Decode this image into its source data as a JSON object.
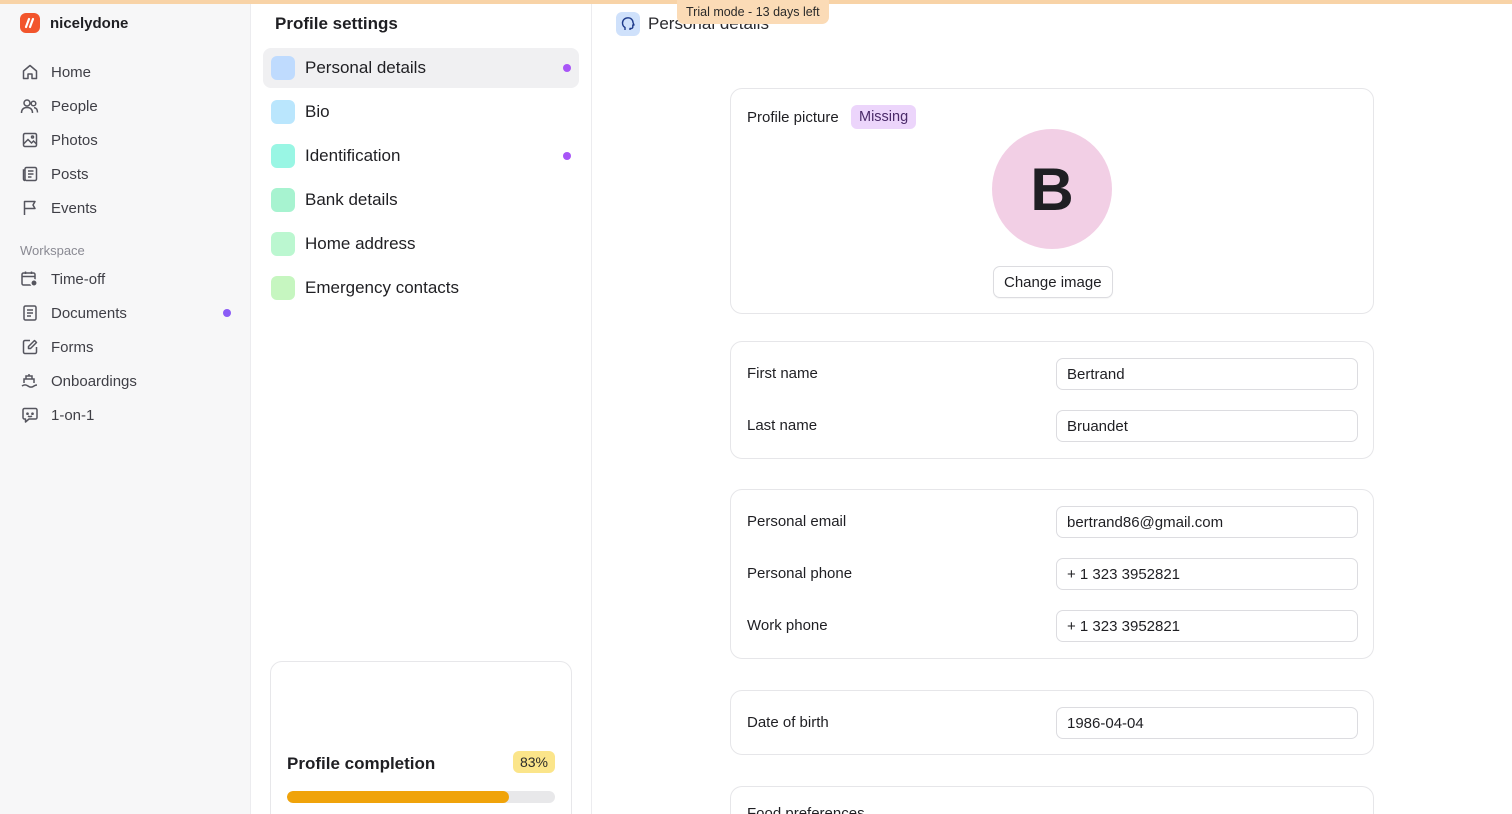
{
  "trial_badge": "Trial mode - 13 days left",
  "brand": {
    "name": "nicelydone",
    "logo_color": "#f2552c"
  },
  "sidebar": {
    "items": [
      {
        "label": "Home",
        "icon": "home-icon"
      },
      {
        "label": "People",
        "icon": "people-icon"
      },
      {
        "label": "Photos",
        "icon": "photos-icon"
      },
      {
        "label": "Posts",
        "icon": "posts-icon"
      },
      {
        "label": "Events",
        "icon": "flag-icon"
      }
    ],
    "workspace_label": "Workspace",
    "workspace_items": [
      {
        "label": "Time-off",
        "icon": "calendar-clock-icon"
      },
      {
        "label": "Documents",
        "icon": "document-icon",
        "dot": true
      },
      {
        "label": "Forms",
        "icon": "form-icon"
      },
      {
        "label": "Onboardings",
        "icon": "onboarding-icon"
      },
      {
        "label": "1-on-1",
        "icon": "chat-icon"
      }
    ]
  },
  "settings": {
    "title": "Profile settings",
    "menu": [
      {
        "label": "Personal details",
        "color": "#bfdbfe",
        "dot": true,
        "active": true
      },
      {
        "label": "Bio",
        "color": "#bae6fd",
        "dot": false
      },
      {
        "label": "Identification",
        "color": "#99f6e4",
        "dot": true
      },
      {
        "label": "Bank details",
        "color": "#a7f3d0",
        "dot": false
      },
      {
        "label": "Home address",
        "color": "#bbf7d0",
        "dot": false
      },
      {
        "label": "Emergency contacts",
        "color": "#c6f6c0",
        "dot": false
      }
    ],
    "completion": {
      "title": "Profile completion",
      "percent_label": "83%",
      "percent": 83
    }
  },
  "main": {
    "header_title": "Personal details",
    "profile_picture": {
      "label": "Profile picture",
      "badge": "Missing",
      "avatar_letter": "B",
      "button": "Change image"
    },
    "name": {
      "first_label": "First name",
      "first_value": "Bertrand",
      "last_label": "Last name",
      "last_value": "Bruandet"
    },
    "contact": {
      "email_label": "Personal email",
      "email_value": "bertrand86@gmail.com",
      "phone_label": "Personal phone",
      "phone_value": "+ 1 323 3952821",
      "work_label": "Work phone",
      "work_value": "+ 1 323 3952821"
    },
    "dob": {
      "label": "Date of birth",
      "value": "1986-04-04"
    },
    "food": {
      "label": "Food preferences"
    }
  }
}
